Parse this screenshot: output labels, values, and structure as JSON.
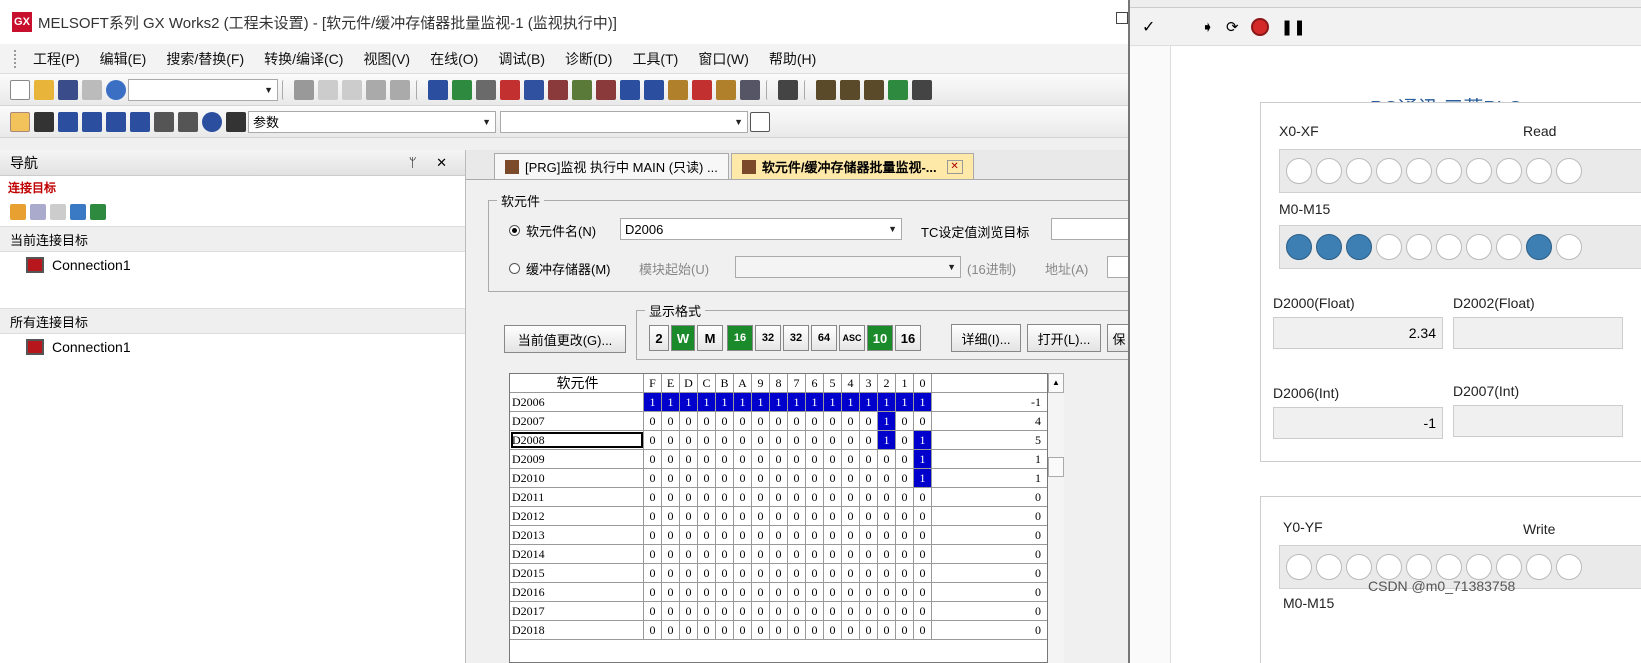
{
  "window": {
    "title": "MELSOFT系列 GX Works2 (工程未设置) - [软元件/缓冲存储器批量监视-1 (监视执行中)]",
    "logo": "GX"
  },
  "menu": [
    "工程(P)",
    "编辑(E)",
    "搜索/替换(F)",
    "转换/编译(C)",
    "视图(V)",
    "在线(O)",
    "调试(B)",
    "诊断(D)",
    "工具(T)",
    "窗口(W)",
    "帮助(H)"
  ],
  "toolbar3": {
    "combo_value": "参数"
  },
  "nav": {
    "title": "导航",
    "pins": "ᛘ ✕",
    "section": "连接目标",
    "current_header": "当前连接目标",
    "current_item": "Connection1",
    "all_header": "所有连接目标",
    "all_item": "Connection1"
  },
  "tabs": [
    {
      "label": "[PRG]监视 执行中 MAIN (只读) ..."
    },
    {
      "label": "软元件/缓冲存储器批量监视-...",
      "close": "✕"
    }
  ],
  "device": {
    "legend": "软元件",
    "radio_device": "软元件名(N)",
    "device_value": "D2006",
    "tc_label": "TC设定值浏览目标",
    "radio_buffer": "缓冲存储器(M)",
    "module_start": "模块起始(U)",
    "hex_label": "(16进制)",
    "addr_label": "地址(A)"
  },
  "format": {
    "legend": "显示格式",
    "buttons": [
      "2",
      "W",
      "M",
      "16",
      "32",
      "32",
      "64",
      "ASC",
      "10",
      "16"
    ],
    "detail": "详细(I)...",
    "open": "打开(L)...",
    "save": "保"
  },
  "change_btn": "当前值更改(G)...",
  "grid": {
    "header_name": "软元件",
    "bits": [
      "F",
      "E",
      "D",
      "C",
      "B",
      "A",
      "9",
      "8",
      "7",
      "6",
      "5",
      "4",
      "3",
      "2",
      "1",
      "0"
    ],
    "rows": [
      {
        "name": "D2006",
        "bits": [
          "1",
          "1",
          "1",
          "1",
          "1",
          "1",
          "1",
          "1",
          "1",
          "1",
          "1",
          "1",
          "1",
          "1",
          "1",
          "1"
        ],
        "hi": [
          1,
          1,
          1,
          1,
          1,
          1,
          1,
          1,
          1,
          1,
          1,
          1,
          1,
          1,
          1,
          1
        ],
        "value": "-1"
      },
      {
        "name": "D2007",
        "bits": [
          "0",
          "0",
          "0",
          "0",
          "0",
          "0",
          "0",
          "0",
          "0",
          "0",
          "0",
          "0",
          "0",
          "1",
          "0",
          "0"
        ],
        "hi": [
          0,
          0,
          0,
          0,
          0,
          0,
          0,
          0,
          0,
          0,
          0,
          0,
          0,
          1,
          0,
          0
        ],
        "value": "4"
      },
      {
        "name": "D2008",
        "bits": [
          "0",
          "0",
          "0",
          "0",
          "0",
          "0",
          "0",
          "0",
          "0",
          "0",
          "0",
          "0",
          "0",
          "1",
          "0",
          "1"
        ],
        "hi": [
          0,
          0,
          0,
          0,
          0,
          0,
          0,
          0,
          0,
          0,
          0,
          0,
          0,
          1,
          0,
          1
        ],
        "value": "5",
        "sel": true
      },
      {
        "name": "D2009",
        "bits": [
          "0",
          "0",
          "0",
          "0",
          "0",
          "0",
          "0",
          "0",
          "0",
          "0",
          "0",
          "0",
          "0",
          "0",
          "0",
          "1"
        ],
        "hi": [
          0,
          0,
          0,
          0,
          0,
          0,
          0,
          0,
          0,
          0,
          0,
          0,
          0,
          0,
          0,
          1
        ],
        "value": "1"
      },
      {
        "name": "D2010",
        "bits": [
          "0",
          "0",
          "0",
          "0",
          "0",
          "0",
          "0",
          "0",
          "0",
          "0",
          "0",
          "0",
          "0",
          "0",
          "0",
          "1"
        ],
        "hi": [
          0,
          0,
          0,
          0,
          0,
          0,
          0,
          0,
          0,
          0,
          0,
          0,
          0,
          0,
          0,
          1
        ],
        "value": "1"
      },
      {
        "name": "D2011",
        "bits": [
          "0",
          "0",
          "0",
          "0",
          "0",
          "0",
          "0",
          "0",
          "0",
          "0",
          "0",
          "0",
          "0",
          "0",
          "0",
          "0"
        ],
        "hi": [
          0,
          0,
          0,
          0,
          0,
          0,
          0,
          0,
          0,
          0,
          0,
          0,
          0,
          0,
          0,
          0
        ],
        "value": "0"
      },
      {
        "name": "D2012",
        "bits": [
          "0",
          "0",
          "0",
          "0",
          "0",
          "0",
          "0",
          "0",
          "0",
          "0",
          "0",
          "0",
          "0",
          "0",
          "0",
          "0"
        ],
        "hi": [
          0,
          0,
          0,
          0,
          0,
          0,
          0,
          0,
          0,
          0,
          0,
          0,
          0,
          0,
          0,
          0
        ],
        "value": "0"
      },
      {
        "name": "D2013",
        "bits": [
          "0",
          "0",
          "0",
          "0",
          "0",
          "0",
          "0",
          "0",
          "0",
          "0",
          "0",
          "0",
          "0",
          "0",
          "0",
          "0"
        ],
        "hi": [
          0,
          0,
          0,
          0,
          0,
          0,
          0,
          0,
          0,
          0,
          0,
          0,
          0,
          0,
          0,
          0
        ],
        "value": "0"
      },
      {
        "name": "D2014",
        "bits": [
          "0",
          "0",
          "0",
          "0",
          "0",
          "0",
          "0",
          "0",
          "0",
          "0",
          "0",
          "0",
          "0",
          "0",
          "0",
          "0"
        ],
        "hi": [
          0,
          0,
          0,
          0,
          0,
          0,
          0,
          0,
          0,
          0,
          0,
          0,
          0,
          0,
          0,
          0
        ],
        "value": "0"
      },
      {
        "name": "D2015",
        "bits": [
          "0",
          "0",
          "0",
          "0",
          "0",
          "0",
          "0",
          "0",
          "0",
          "0",
          "0",
          "0",
          "0",
          "0",
          "0",
          "0"
        ],
        "hi": [
          0,
          0,
          0,
          0,
          0,
          0,
          0,
          0,
          0,
          0,
          0,
          0,
          0,
          0,
          0,
          0
        ],
        "value": "0"
      },
      {
        "name": "D2016",
        "bits": [
          "0",
          "0",
          "0",
          "0",
          "0",
          "0",
          "0",
          "0",
          "0",
          "0",
          "0",
          "0",
          "0",
          "0",
          "0",
          "0"
        ],
        "hi": [
          0,
          0,
          0,
          0,
          0,
          0,
          0,
          0,
          0,
          0,
          0,
          0,
          0,
          0,
          0,
          0
        ],
        "value": "0"
      },
      {
        "name": "D2017",
        "bits": [
          "0",
          "0",
          "0",
          "0",
          "0",
          "0",
          "0",
          "0",
          "0",
          "0",
          "0",
          "0",
          "0",
          "0",
          "0",
          "0"
        ],
        "hi": [
          0,
          0,
          0,
          0,
          0,
          0,
          0,
          0,
          0,
          0,
          0,
          0,
          0,
          0,
          0,
          0
        ],
        "value": "0"
      },
      {
        "name": "D2018",
        "bits": [
          "0",
          "0",
          "0",
          "0",
          "0",
          "0",
          "0",
          "0",
          "0",
          "0",
          "0",
          "0",
          "0",
          "0",
          "0",
          "0"
        ],
        "hi": [
          0,
          0,
          0,
          0,
          0,
          0,
          0,
          0,
          0,
          0,
          0,
          0,
          0,
          0,
          0,
          0
        ],
        "value": "0"
      }
    ]
  },
  "right": {
    "check": "✓",
    "title": "PC通讯 三菱PLC",
    "x_label": "X0-XF",
    "read_label": "Read",
    "m_label": "M0-M15",
    "m_leds": [
      1,
      1,
      1,
      0,
      0,
      0,
      0,
      0,
      1,
      0
    ],
    "x_leds": [
      0,
      0,
      0,
      0,
      0,
      0,
      0,
      0,
      0,
      0
    ],
    "d2000_label": "D2000(Float)",
    "d2000_value": "2.34",
    "d2002_label": "D2002(Float)",
    "d2006_label": "D2006(Int)",
    "d2006_value": "-1",
    "d2007_label": "D2007(Int)",
    "y_label": "Y0-YF",
    "write_label": "Write",
    "m2_label": "M0-M15",
    "y_leds": [
      0,
      0,
      0,
      0,
      0,
      0,
      0,
      0,
      0,
      0
    ]
  },
  "watermark": "CSDN @m0_71383758",
  "colors": {
    "highlight": "#0000cc",
    "led_on": "#3d7fb3",
    "title_blue": "#2a5d9a"
  }
}
